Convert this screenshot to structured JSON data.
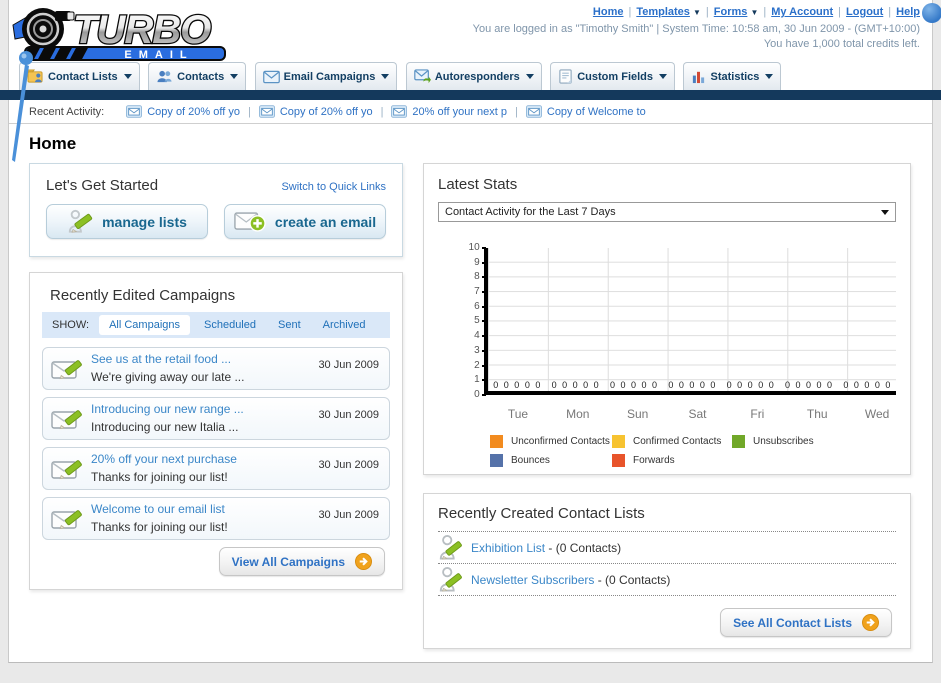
{
  "header": {
    "nav_links": [
      {
        "label": "Home",
        "dropdown": false
      },
      {
        "label": "Templates",
        "dropdown": true
      },
      {
        "label": "Forms",
        "dropdown": true
      },
      {
        "label": "My Account",
        "dropdown": false
      },
      {
        "label": "Logout",
        "dropdown": false
      },
      {
        "label": "Help",
        "dropdown": false
      }
    ],
    "login_line": "You are logged in as \"Timothy Smith\" | System Time: 10:58 am, 30 Jun 2009 - (GMT+10:00)",
    "credits_line": "You have 1,000 total credits left.",
    "logo_top": "TURBO",
    "logo_bottom": "E M A I L"
  },
  "nav_tabs": [
    {
      "label": "Contact Lists"
    },
    {
      "label": "Contacts"
    },
    {
      "label": "Email Campaigns"
    },
    {
      "label": "Autoresponders"
    },
    {
      "label": "Custom Fields"
    },
    {
      "label": "Statistics"
    }
  ],
  "recent_activity": {
    "label": "Recent Activity:",
    "items": [
      {
        "text": "Copy of 20% off yo"
      },
      {
        "text": "Copy of 20% off yo"
      },
      {
        "text": "20% off your next p"
      },
      {
        "text": "Copy of Welcome to"
      }
    ]
  },
  "page_title": "Home",
  "get_started": {
    "title": "Let's Get Started",
    "switch_link": "Switch to Quick Links",
    "manage_lists_label": "manage lists",
    "create_email_label": "create an email"
  },
  "campaigns": {
    "title": "Recently Edited Campaigns",
    "show_label": "SHOW:",
    "tabs": [
      {
        "label": "All Campaigns",
        "active": true
      },
      {
        "label": "Scheduled",
        "active": false
      },
      {
        "label": "Sent",
        "active": false
      },
      {
        "label": "Archived",
        "active": false
      }
    ],
    "items": [
      {
        "title": "See us at the retail food ...",
        "subtitle": "We're giving away our late ...",
        "date": "30 Jun 2009"
      },
      {
        "title": "Introducing our new range ...",
        "subtitle": "Introducing our new Italia ...",
        "date": "30 Jun 2009"
      },
      {
        "title": "20% off your next purchase",
        "subtitle": "Thanks for joining our list!",
        "date": "30 Jun 2009"
      },
      {
        "title": "Welcome to our email list",
        "subtitle": "Thanks for joining our list!",
        "date": "30 Jun 2009"
      }
    ],
    "view_all_label": "View All Campaigns"
  },
  "stats": {
    "title": "Latest Stats",
    "dropdown_value": "Contact Activity for the Last 7 Days",
    "chart_data": {
      "type": "bar",
      "title": "Contact Activity for the Last 7 Days",
      "categories": [
        "Tue",
        "Mon",
        "Sun",
        "Sat",
        "Fri",
        "Thu",
        "Wed"
      ],
      "series": [
        {
          "name": "Unconfirmed Contacts",
          "color": "#f28b1f",
          "values": [
            0,
            0,
            0,
            0,
            0,
            0,
            0
          ]
        },
        {
          "name": "Confirmed Contacts",
          "color": "#f7c331",
          "values": [
            0,
            0,
            0,
            0,
            0,
            0,
            0
          ]
        },
        {
          "name": "Unsubscribes",
          "color": "#71a829",
          "values": [
            0,
            0,
            0,
            0,
            0,
            0,
            0
          ]
        },
        {
          "name": "Bounces",
          "color": "#5572a9",
          "values": [
            0,
            0,
            0,
            0,
            0,
            0,
            0
          ]
        },
        {
          "name": "Forwards",
          "color": "#e8542b",
          "values": [
            0,
            0,
            0,
            0,
            0,
            0,
            0
          ]
        }
      ],
      "ylim": [
        0,
        10
      ],
      "yticks": [
        "10",
        "9",
        "8",
        "7",
        "6",
        "5",
        "4",
        "3",
        "2",
        "1",
        "0"
      ],
      "zeros_row": "0 0 0 0 0",
      "grid": true,
      "legend_position": "bottom"
    }
  },
  "contact_lists": {
    "title": "Recently Created Contact Lists",
    "items": [
      {
        "name": "Exhibition List",
        "suffix": "- (0 Contacts)"
      },
      {
        "name": "Newsletter Subscribers",
        "suffix": "- (0 Contacts)"
      }
    ],
    "see_all_label": "See All Contact Lists"
  }
}
